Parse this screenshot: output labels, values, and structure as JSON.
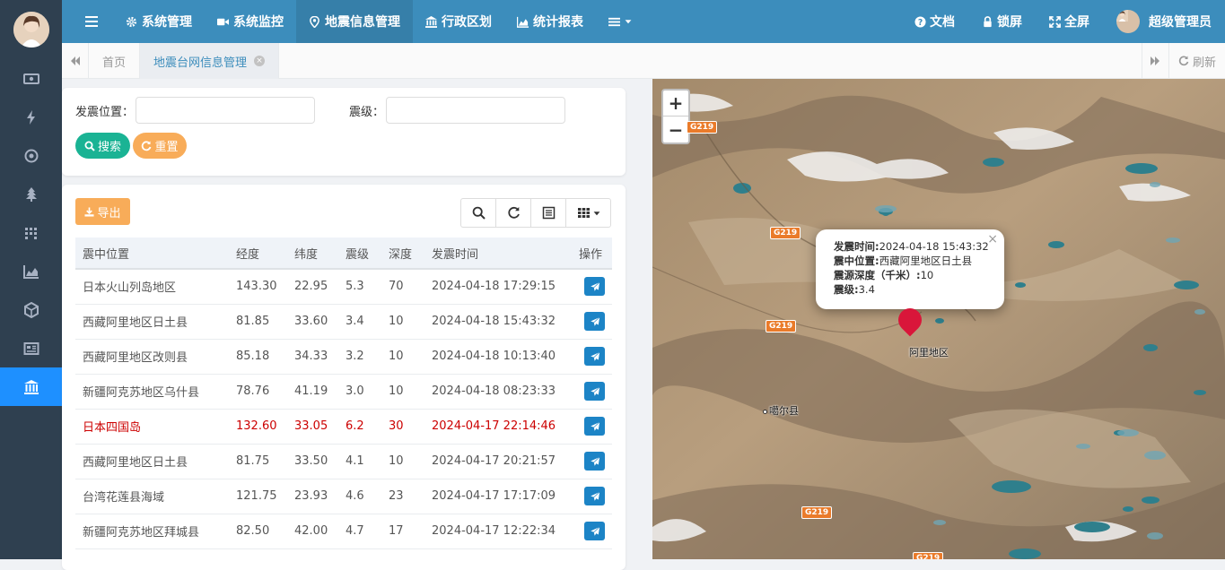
{
  "top_nav": {
    "items": [
      {
        "label": "系统管理",
        "icon": "gear-icon"
      },
      {
        "label": "系统监控",
        "icon": "video-icon"
      },
      {
        "label": "地震信息管理",
        "icon": "map-pin-icon"
      },
      {
        "label": "行政区划",
        "icon": "bank-icon"
      },
      {
        "label": "统计报表",
        "icon": "area-chart-icon"
      }
    ],
    "doc": "文档",
    "lock": "锁屏",
    "fullscreen": "全屏",
    "user": "超级管理员"
  },
  "tabs": {
    "home": "首页",
    "active": "地震台网信息管理",
    "refresh": "刷新"
  },
  "search": {
    "location_label": "发震位置：",
    "magnitude_label": "震级：",
    "location_value": "",
    "magnitude_value": "",
    "search_btn": "搜索",
    "reset_btn": "重置"
  },
  "toolbar": {
    "export_btn": "导出"
  },
  "table": {
    "headers": [
      "震中位置",
      "经度",
      "纬度",
      "震级",
      "深度",
      "发震时间",
      "操作"
    ],
    "rows": [
      {
        "loc": "日本火山列岛地区",
        "lng": "143.30",
        "lat": "22.95",
        "mag": "5.3",
        "depth": "70",
        "time": "2024-04-18 17:29:15",
        "highlight": false
      },
      {
        "loc": "西藏阿里地区日土县",
        "lng": "81.85",
        "lat": "33.60",
        "mag": "3.4",
        "depth": "10",
        "time": "2024-04-18 15:43:32",
        "highlight": false
      },
      {
        "loc": "西藏阿里地区改则县",
        "lng": "85.18",
        "lat": "34.33",
        "mag": "3.2",
        "depth": "10",
        "time": "2024-04-18 10:13:40",
        "highlight": false
      },
      {
        "loc": "新疆阿克苏地区乌什县",
        "lng": "78.76",
        "lat": "41.19",
        "mag": "3.0",
        "depth": "10",
        "time": "2024-04-18 08:23:33",
        "highlight": false
      },
      {
        "loc": "日本四国岛",
        "lng": "132.60",
        "lat": "33.05",
        "mag": "6.2",
        "depth": "30",
        "time": "2024-04-17 22:14:46",
        "highlight": true
      },
      {
        "loc": "西藏阿里地区日土县",
        "lng": "81.75",
        "lat": "33.50",
        "mag": "4.1",
        "depth": "10",
        "time": "2024-04-17 20:21:57",
        "highlight": false
      },
      {
        "loc": "台湾花莲县海域",
        "lng": "121.75",
        "lat": "23.93",
        "mag": "4.6",
        "depth": "23",
        "time": "2024-04-17 17:17:09",
        "highlight": false
      },
      {
        "loc": "新疆阿克苏地区拜城县",
        "lng": "82.50",
        "lat": "42.00",
        "mag": "4.7",
        "depth": "17",
        "time": "2024-04-17 12:22:34",
        "highlight": false
      }
    ]
  },
  "map": {
    "zoom_in": "+",
    "zoom_out": "−",
    "roads": [
      "G219",
      "G219",
      "G219",
      "G219",
      "G219"
    ],
    "places": {
      "ali": "阿里地区",
      "gaer": "噶尔县"
    },
    "popup": {
      "time_label": "发震时间:",
      "time_value": "2024-04-18 15:43:32",
      "loc_label": "震中位置:",
      "loc_value": "西藏阿里地区日土县",
      "depth_label": "震源深度（千米）:",
      "depth_value": "10",
      "mag_label": "震级:",
      "mag_value": "3.4"
    }
  },
  "colors": {
    "sidebar": "#2f4050",
    "topbar": "#3c8dbc",
    "search_btn": "#1ab394",
    "reset_btn": "#f8ac59",
    "op_btn": "#1c84c6",
    "highlight_text": "#cc0000"
  }
}
